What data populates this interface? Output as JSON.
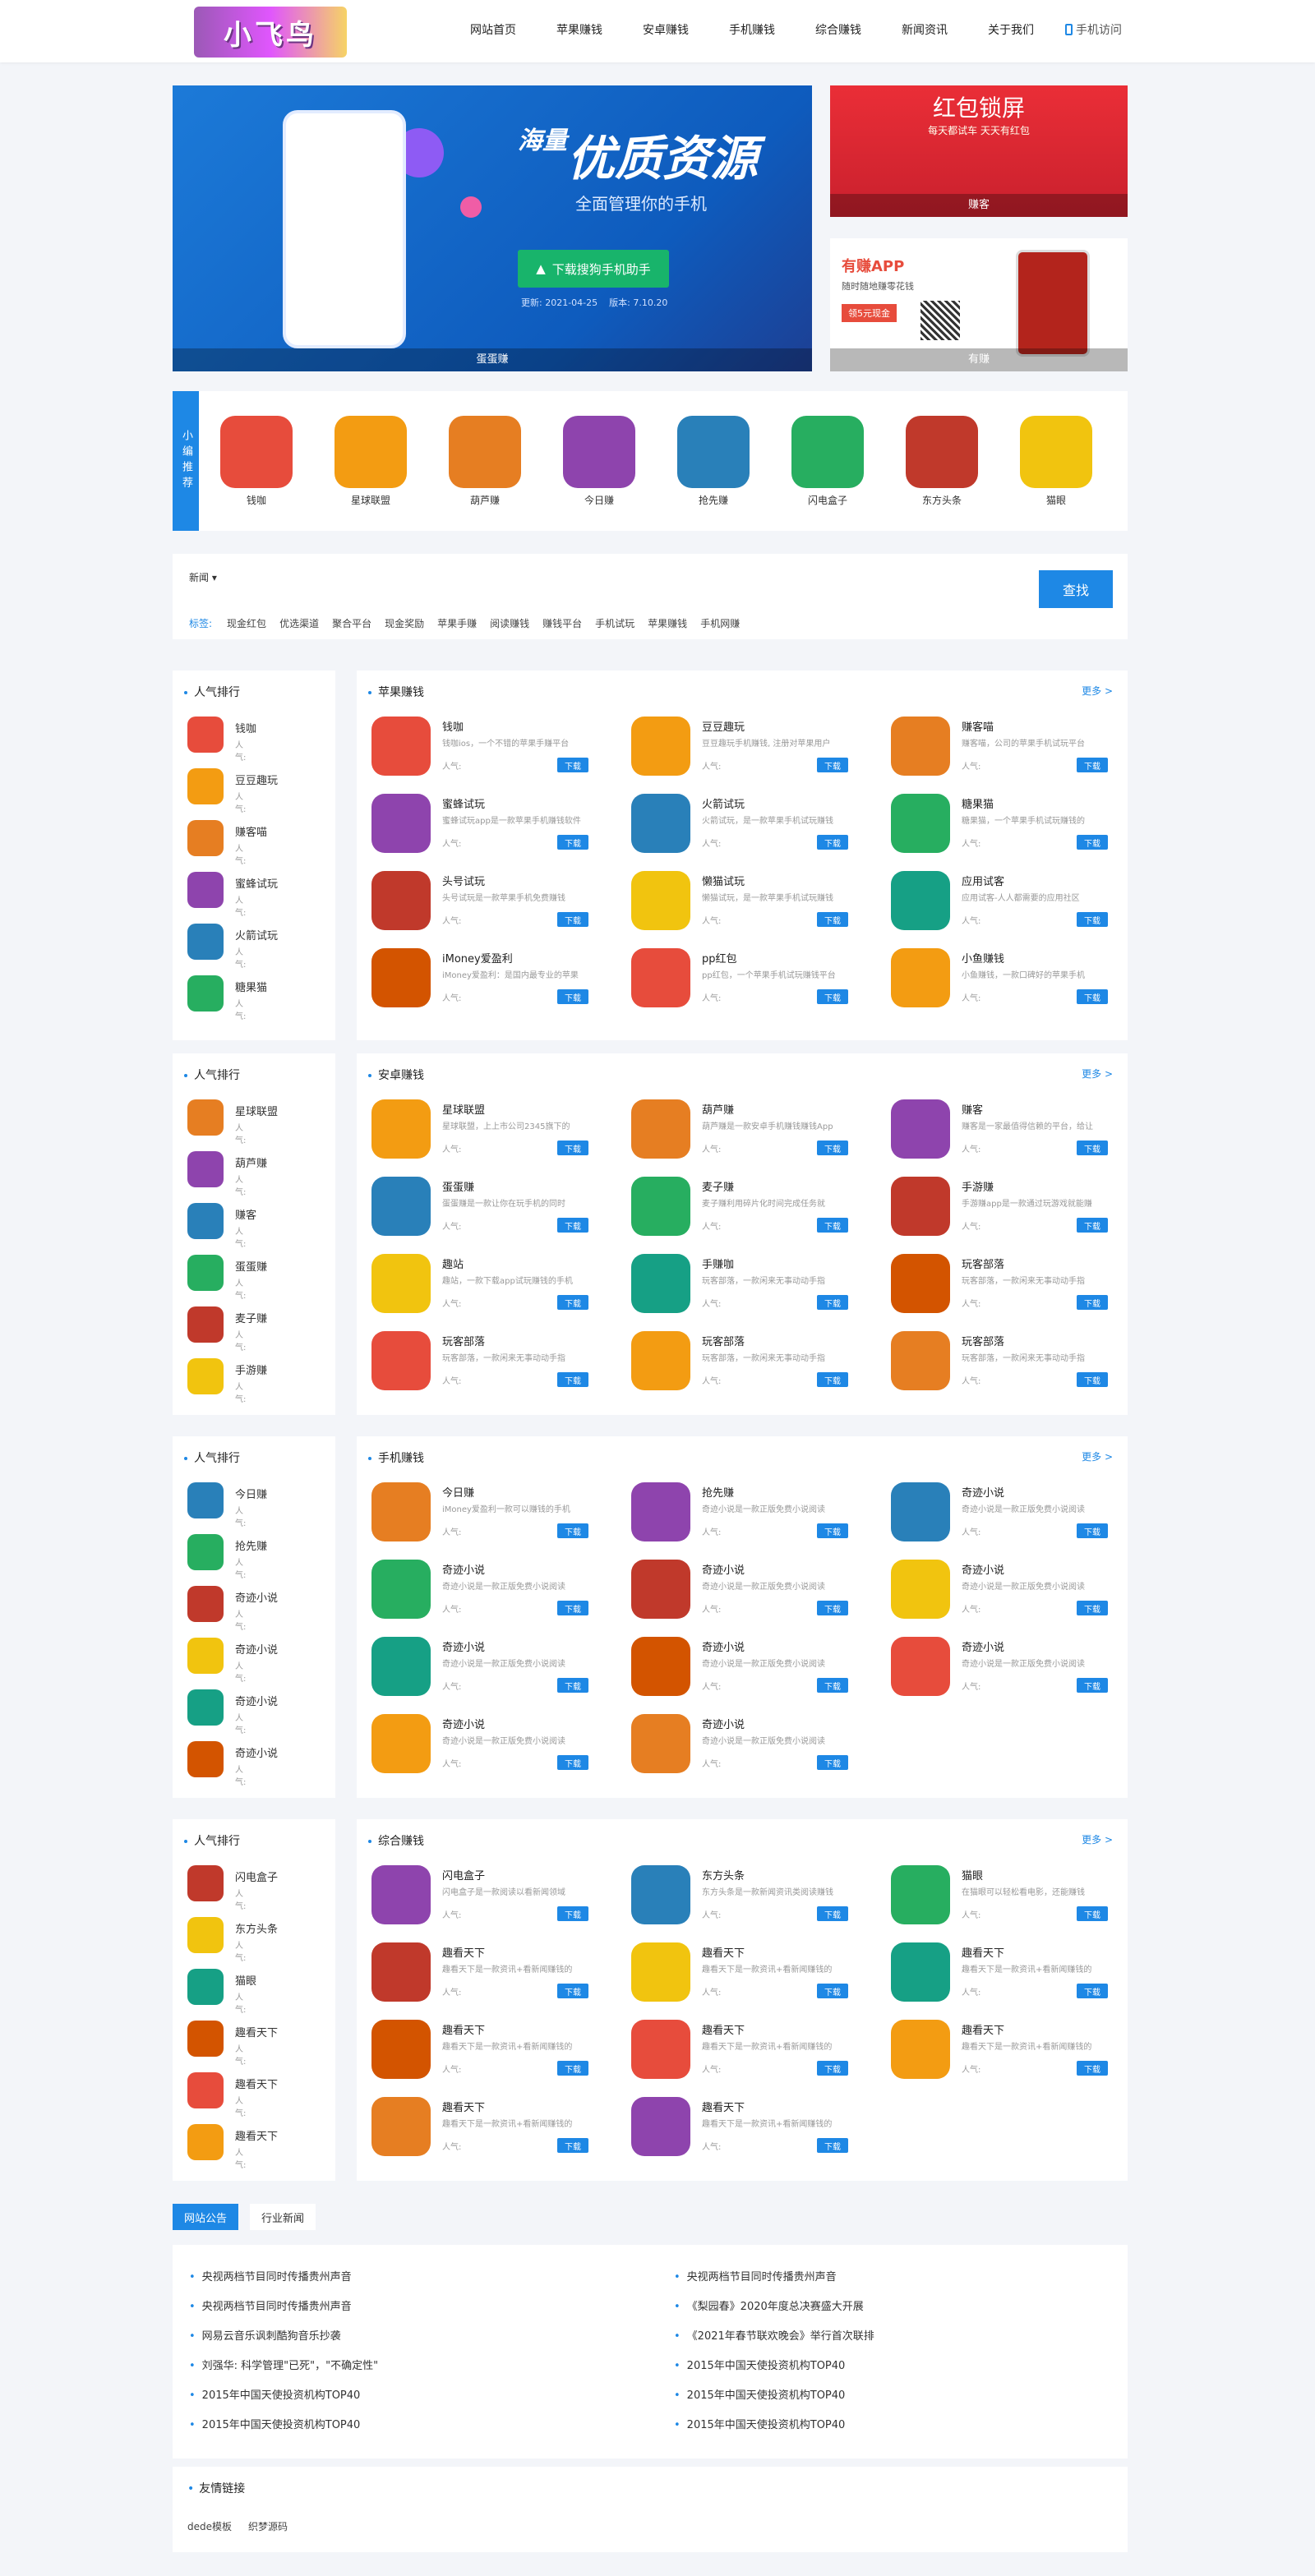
{
  "logo": "小飞鸟",
  "nav": [
    "网站首页",
    "苹果赚钱",
    "安卓赚钱",
    "手机赚钱",
    "综合赚钱",
    "新闻资讯",
    "关于我们"
  ],
  "mobile": "手机访问",
  "banner": {
    "title": "优质资源",
    "title_prefix": "海量",
    "subtitle": "全面管理你的手机",
    "button": "下载搜狗手机助手",
    "date": "更新: 2021-04-25",
    "version": "版本: 7.10.20",
    "caption": "蛋蛋赚"
  },
  "ad1": {
    "title": "红包锁屏",
    "sub": "每天都试车 天天有红包",
    "caption": "赚客"
  },
  "ad2": {
    "title": "有赚APP",
    "sub": "随时随地赚零花钱",
    "tag": "领5元现金",
    "caption": "有赚"
  },
  "recommend": {
    "label": "小编推荐",
    "items": [
      "钱咖",
      "星球联盟",
      "葫芦赚",
      "今日赚",
      "抢先赚",
      "闪电盒子",
      "东方头条",
      "猫眼"
    ]
  },
  "search": {
    "select": "新闻",
    "placeholder": "",
    "button": "查找",
    "tags_label": "标签:",
    "tags": [
      "现金红包",
      "优选渠道",
      "聚合平台",
      "现金奖励",
      "苹果手赚",
      "阅读赚钱",
      "赚钱平台",
      "手机试玩",
      "苹果赚钱",
      "手机网赚"
    ]
  },
  "sections": [
    {
      "title": "苹果赚钱",
      "rank_title": "人气排行",
      "rank": [
        "钱咖",
        "豆豆趣玩",
        "赚客喵",
        "蜜蜂试玩",
        "火箭试玩",
        "糖果猫"
      ],
      "apps": [
        {
          "name": "钱咖",
          "desc": "钱咖ios，一个不错的苹果手赚平台"
        },
        {
          "name": "豆豆趣玩",
          "desc": "豆豆趣玩手机赚钱, 注册对苹果用户"
        },
        {
          "name": "赚客喵",
          "desc": "赚客喵，公司的苹果手机试玩平台"
        },
        {
          "name": "蜜蜂试玩",
          "desc": "蜜蜂试玩app是一款苹果手机赚钱软件"
        },
        {
          "name": "火箭试玩",
          "desc": "火箭试玩，是一款苹果手机试玩赚钱"
        },
        {
          "name": "糖果猫",
          "desc": "糖果猫，一个苹果手机试玩赚钱的"
        },
        {
          "name": "头号试玩",
          "desc": "头号试玩是一款苹果手机免费赚钱"
        },
        {
          "name": "懒猫试玩",
          "desc": "懒猫试玩，是一款苹果手机试玩赚钱"
        },
        {
          "name": "应用试客",
          "desc": "应用试客-人人都需要的应用社区"
        },
        {
          "name": "iMoney爱盈利",
          "desc": "iMoney爱盈利：是国内最专业的苹果"
        },
        {
          "name": "pp红包",
          "desc": "pp红包，一个苹果手机试玩赚钱平台"
        },
        {
          "name": "小鱼赚钱",
          "desc": "小鱼赚钱，一款口碑好的苹果手机"
        }
      ]
    },
    {
      "title": "安卓赚钱",
      "rank_title": "人气排行",
      "rank": [
        "星球联盟",
        "葫芦赚",
        "赚客",
        "蛋蛋赚",
        "麦子赚",
        "手游赚"
      ],
      "apps": [
        {
          "name": "星球联盟",
          "desc": "星球联盟，上上市公司2345旗下的"
        },
        {
          "name": "葫芦赚",
          "desc": "葫芦赚是一款安卓手机赚钱赚钱App"
        },
        {
          "name": "赚客",
          "desc": "赚客是一家最值得信赖的平台，给让"
        },
        {
          "name": "蛋蛋赚",
          "desc": "蛋蛋赚是一款让你在玩手机的同时"
        },
        {
          "name": "麦子赚",
          "desc": "麦子赚利用碎片化时间完成任务就"
        },
        {
          "name": "手游赚",
          "desc": "手游赚app是一款通过玩游戏就能赚"
        },
        {
          "name": "趣站",
          "desc": "趣站，一款下载app试玩赚钱的手机"
        },
        {
          "name": "手赚咖",
          "desc": "玩客部落，一款闲来无事动动手指"
        },
        {
          "name": "玩客部落",
          "desc": "玩客部落，一款闲来无事动动手指"
        },
        {
          "name": "玩客部落",
          "desc": "玩客部落，一款闲来无事动动手指"
        },
        {
          "name": "玩客部落",
          "desc": "玩客部落，一款闲来无事动动手指"
        },
        {
          "name": "玩客部落",
          "desc": "玩客部落，一款闲来无事动动手指"
        }
      ]
    },
    {
      "title": "手机赚钱",
      "rank_title": "人气排行",
      "rank": [
        "今日赚",
        "抢先赚",
        "奇迹小说",
        "奇迹小说",
        "奇迹小说",
        "奇迹小说"
      ],
      "apps": [
        {
          "name": "今日赚",
          "desc": "iMoney爱盈利一款可以赚钱的手机"
        },
        {
          "name": "抢先赚",
          "desc": "奇迹小说是一款正版免费小说阅读"
        },
        {
          "name": "奇迹小说",
          "desc": "奇迹小说是一款正版免费小说阅读"
        },
        {
          "name": "奇迹小说",
          "desc": "奇迹小说是一款正版免费小说阅读"
        },
        {
          "name": "奇迹小说",
          "desc": "奇迹小说是一款正版免费小说阅读"
        },
        {
          "name": "奇迹小说",
          "desc": "奇迹小说是一款正版免费小说阅读"
        },
        {
          "name": "奇迹小说",
          "desc": "奇迹小说是一款正版免费小说阅读"
        },
        {
          "name": "奇迹小说",
          "desc": "奇迹小说是一款正版免费小说阅读"
        },
        {
          "name": "奇迹小说",
          "desc": "奇迹小说是一款正版免费小说阅读"
        },
        {
          "name": "奇迹小说",
          "desc": "奇迹小说是一款正版免费小说阅读"
        },
        {
          "name": "奇迹小说",
          "desc": "奇迹小说是一款正版免费小说阅读"
        }
      ]
    },
    {
      "title": "综合赚钱",
      "rank_title": "人气排行",
      "rank": [
        "闪电盒子",
        "东方头条",
        "猫眼",
        "趣看天下",
        "趣看天下",
        "趣看天下"
      ],
      "apps": [
        {
          "name": "闪电盒子",
          "desc": "闪电盒子是一款阅读以看新闻领域"
        },
        {
          "name": "东方头条",
          "desc": "东方头条是一款新闻资讯类阅读赚钱"
        },
        {
          "name": "猫眼",
          "desc": "在猫眼可以轻松看电影，还能赚钱"
        },
        {
          "name": "趣看天下",
          "desc": "趣看天下是一款资讯+看新闻赚钱的"
        },
        {
          "name": "趣看天下",
          "desc": "趣看天下是一款资讯+看新闻赚钱的"
        },
        {
          "name": "趣看天下",
          "desc": "趣看天下是一款资讯+看新闻赚钱的"
        },
        {
          "name": "趣看天下",
          "desc": "趣看天下是一款资讯+看新闻赚钱的"
        },
        {
          "name": "趣看天下",
          "desc": "趣看天下是一款资讯+看新闻赚钱的"
        },
        {
          "name": "趣看天下",
          "desc": "趣看天下是一款资讯+看新闻赚钱的"
        },
        {
          "name": "趣看天下",
          "desc": "趣看天下是一款资讯+看新闻赚钱的"
        },
        {
          "name": "趣看天下",
          "desc": "趣看天下是一款资讯+看新闻赚钱的"
        }
      ]
    }
  ],
  "labels": {
    "more": "更多 >",
    "popularity": "人气:",
    "download": "下载"
  },
  "news_tabs": [
    "网站公告",
    "行业新闻"
  ],
  "news": {
    "left": [
      "央视两档节目同时传播贵州声音",
      "央视两档节目同时传播贵州声音",
      "网易云音乐讽刺酷狗音乐抄袭",
      "刘强华: 科学管理\"已死\"，\"不确定性\"",
      "2015年中国天使投资机构TOP40",
      "2015年中国天使投资机构TOP40"
    ],
    "right": [
      "央视两档节目同时传播贵州声音",
      "《梨园春》2020年度总决赛盛大开展",
      "《2021年春节联欢晚会》举行首次联排",
      "2015年中国天使投资机构TOP40",
      "2015年中国天使投资机构TOP40",
      "2015年中国天使投资机构TOP40"
    ]
  },
  "friend_links": {
    "title": "友情链接",
    "items": [
      "dede模板",
      "织梦源码"
    ]
  },
  "colors": {
    "accent": "#1e88e5",
    "bg": "#f3f5f9"
  }
}
